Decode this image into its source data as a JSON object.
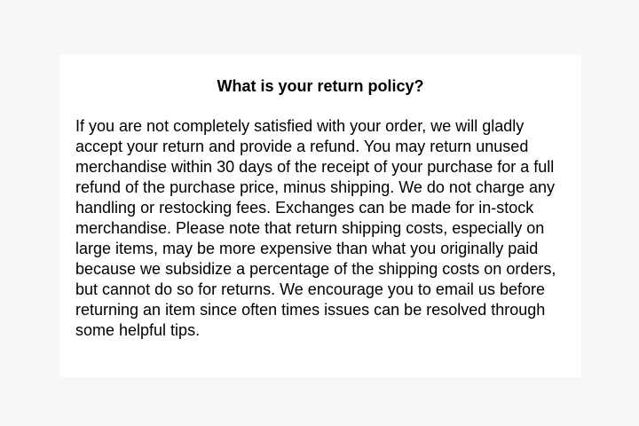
{
  "faq": {
    "question": "What is your return policy?",
    "answer": "If you are not completely satisfied with your order, we will gladly accept your return and provide a refund. You may return unused merchandise within 30 days of the receipt of your purchase for a full refund of the purchase price, minus shipping. We do not charge any handling or restocking fees. Exchanges can be made for in-stock merchandise. Please note that return shipping costs, especially on large items, may be more expensive than what you originally paid because we subsidize a percentage of the shipping costs on orders, but cannot do so for returns. We encourage you to email us before returning an item since often times issues can be resolved through some helpful tips."
  },
  "colors": {
    "background": "#f6f7f9",
    "card": "#ffffff",
    "text": "#000000"
  }
}
